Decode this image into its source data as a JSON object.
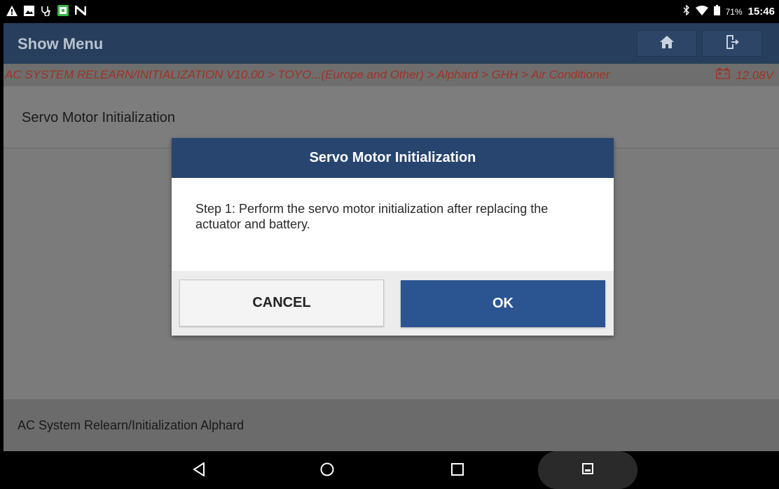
{
  "status_bar": {
    "battery_percent": "71%",
    "time": "15:46",
    "left_icons": [
      "warning-icon",
      "image-icon",
      "stethoscope-icon",
      "app-icon",
      "n-icon"
    ],
    "right_icons": [
      "bluetooth-icon",
      "wifi-icon",
      "battery-icon"
    ]
  },
  "header": {
    "title": "Show Menu",
    "buttons": [
      "home-icon",
      "exit-icon"
    ]
  },
  "breadcrumb": {
    "path": "AC SYSTEM RELEARN/INITIALIZATION V10.00 > TOYO...(Europe and Other) > Alphard > GHH > Air Conditioner",
    "voltage": "12.08V",
    "voltage_icon": "battery-voltage-icon"
  },
  "section": {
    "title": "Servo Motor Initialization"
  },
  "footer": {
    "label": "AC System Relearn/Initialization Alphard"
  },
  "dialog": {
    "title": "Servo Motor Initialization",
    "message": "Step 1: Perform the servo motor initialization after replacing the actuator and battery.",
    "cancel_label": "CANCEL",
    "ok_label": "OK"
  },
  "nav_bar": {
    "buttons": [
      "back-icon",
      "home-circle-icon",
      "recents-icon",
      "screenshot-icon"
    ]
  },
  "colors": {
    "header_bg": "#273e5c",
    "dialog_header_bg": "#27456f",
    "ok_button_bg": "#2b5591",
    "breadcrumb_text": "#a03324"
  }
}
